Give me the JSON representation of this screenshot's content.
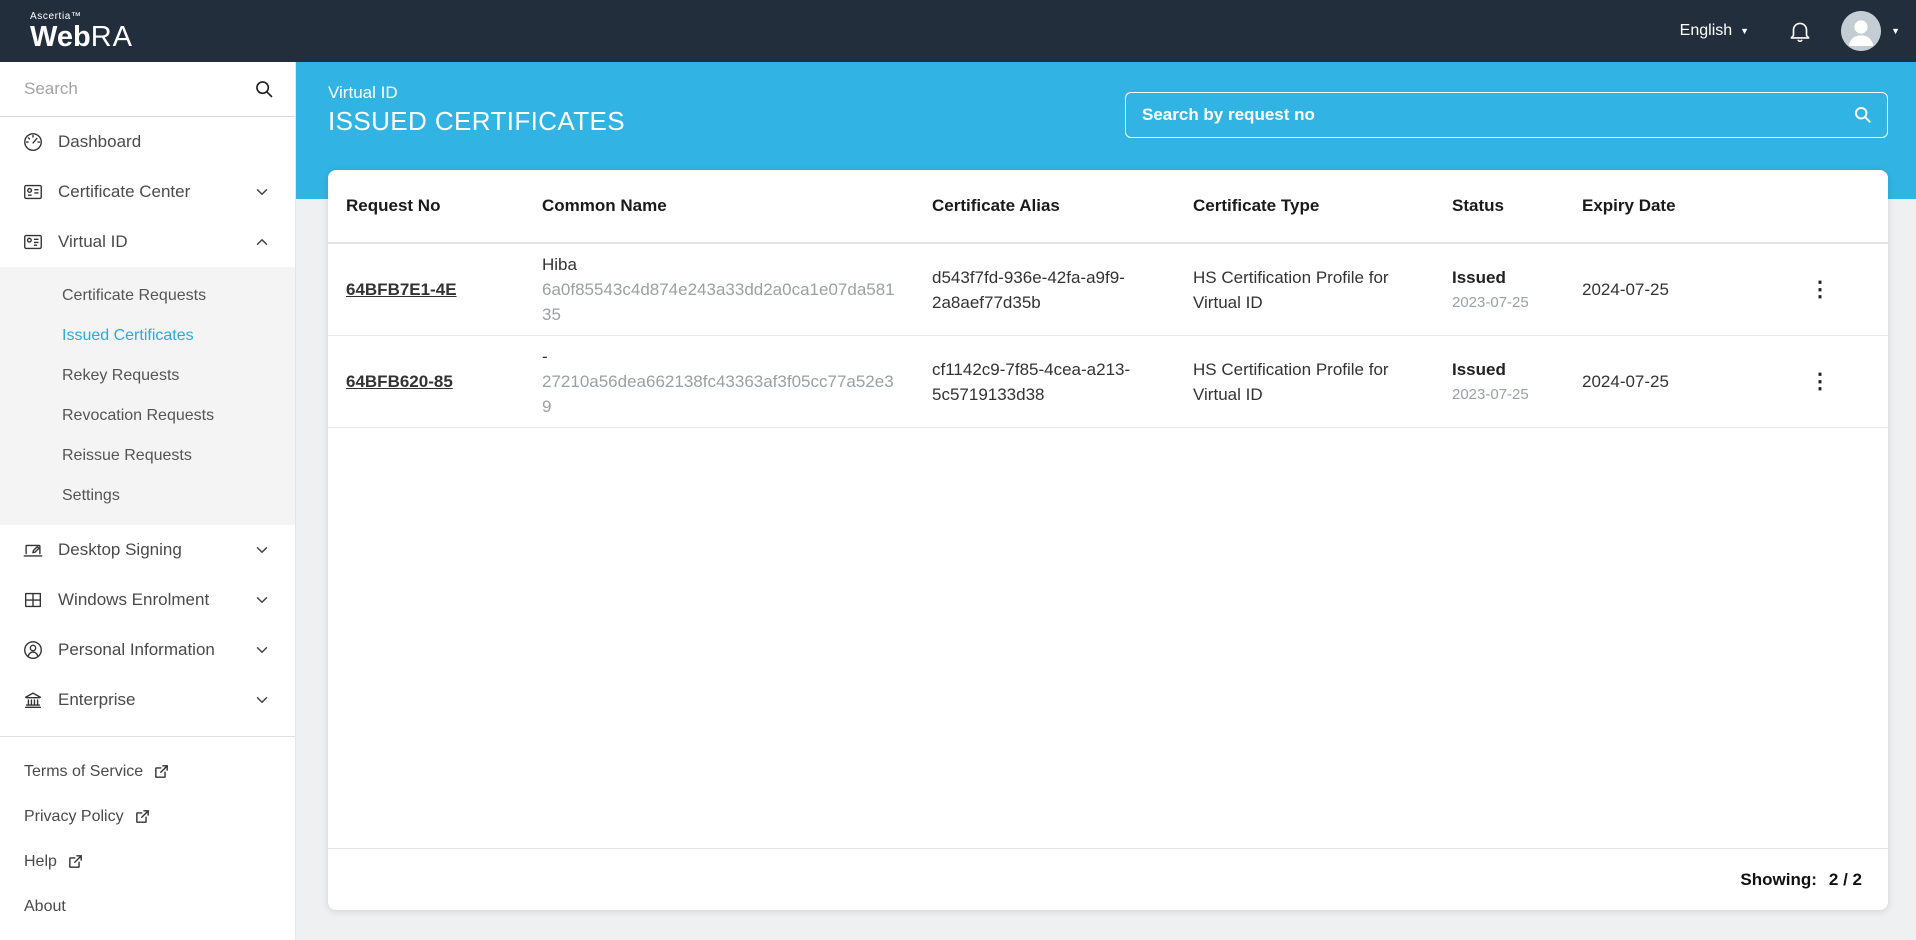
{
  "colors": {
    "accent": "#31b4e4",
    "topbar_bg": "#232e3d",
    "active_item": "#29abe2"
  },
  "icons": {
    "kebab": "⋮",
    "caret_down": "▼"
  },
  "topbar": {
    "brand_small": "Ascertia™",
    "brand_web": "Web",
    "brand_ra": "RA",
    "language": "English"
  },
  "sidebar": {
    "search_placeholder": "Search",
    "dashboard": "Dashboard",
    "certificate_center": "Certificate Center",
    "virtual_id": "Virtual ID",
    "submenu": {
      "certificate_requests": "Certificate Requests",
      "issued_certificates": "Issued Certificates",
      "rekey_requests": "Rekey Requests",
      "revocation_requests": "Revocation Requests",
      "reissue_requests": "Reissue Requests",
      "settings": "Settings"
    },
    "desktop_signing": "Desktop Signing",
    "windows_enrolment": "Windows Enrolment",
    "personal_information": "Personal Information",
    "enterprise": "Enterprise",
    "terms": "Terms of Service",
    "privacy": "Privacy Policy",
    "help": "Help",
    "about": "About"
  },
  "page_header": {
    "breadcrumb": "Virtual ID",
    "title": "ISSUED CERTIFICATES",
    "search_placeholder": "Search by request no"
  },
  "table": {
    "columns": [
      "Request No",
      "Common Name",
      "Certificate Alias",
      "Certificate Type",
      "Status",
      "Expiry Date"
    ],
    "rows": [
      {
        "request_no": "64BFB7E1-4E",
        "common_name": "Hiba",
        "common_name_hash": "6a0f85543c4d874e243a33dd2a0ca1e07da58135",
        "certificate_alias": "d543f7fd-936e-42fa-a9f9-2a8aef77d35b",
        "certificate_type": "HS Certification Profile for Virtual ID",
        "status": "Issued",
        "status_date": "2023-07-25",
        "expiry_date": "2024-07-25"
      },
      {
        "request_no": "64BFB620-85",
        "common_name": "-",
        "common_name_hash": "27210a56dea662138fc43363af3f05cc77a52e39",
        "certificate_alias": "cf1142c9-7f85-4cea-a213-5c5719133d38",
        "certificate_type": "HS Certification Profile for Virtual ID",
        "status": "Issued",
        "status_date": "2023-07-25",
        "expiry_date": "2024-07-25"
      }
    ],
    "footer": {
      "showing_label": "Showing:",
      "showing_value": "2 / 2"
    }
  }
}
